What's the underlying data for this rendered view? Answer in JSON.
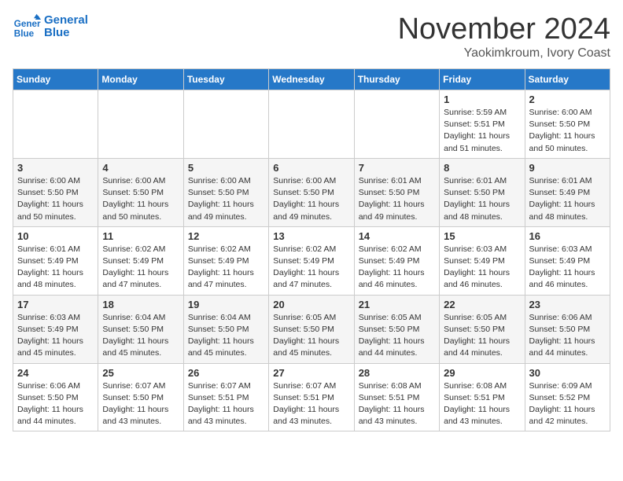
{
  "header": {
    "logo_line1": "General",
    "logo_line2": "Blue",
    "title": "November 2024",
    "subtitle": "Yaokimkroum, Ivory Coast"
  },
  "weekdays": [
    "Sunday",
    "Monday",
    "Tuesday",
    "Wednesday",
    "Thursday",
    "Friday",
    "Saturday"
  ],
  "weeks": [
    [
      {
        "day": "",
        "info": ""
      },
      {
        "day": "",
        "info": ""
      },
      {
        "day": "",
        "info": ""
      },
      {
        "day": "",
        "info": ""
      },
      {
        "day": "",
        "info": ""
      },
      {
        "day": "1",
        "info": "Sunrise: 5:59 AM\nSunset: 5:51 PM\nDaylight: 11 hours\nand 51 minutes."
      },
      {
        "day": "2",
        "info": "Sunrise: 6:00 AM\nSunset: 5:50 PM\nDaylight: 11 hours\nand 50 minutes."
      }
    ],
    [
      {
        "day": "3",
        "info": "Sunrise: 6:00 AM\nSunset: 5:50 PM\nDaylight: 11 hours\nand 50 minutes."
      },
      {
        "day": "4",
        "info": "Sunrise: 6:00 AM\nSunset: 5:50 PM\nDaylight: 11 hours\nand 50 minutes."
      },
      {
        "day": "5",
        "info": "Sunrise: 6:00 AM\nSunset: 5:50 PM\nDaylight: 11 hours\nand 49 minutes."
      },
      {
        "day": "6",
        "info": "Sunrise: 6:00 AM\nSunset: 5:50 PM\nDaylight: 11 hours\nand 49 minutes."
      },
      {
        "day": "7",
        "info": "Sunrise: 6:01 AM\nSunset: 5:50 PM\nDaylight: 11 hours\nand 49 minutes."
      },
      {
        "day": "8",
        "info": "Sunrise: 6:01 AM\nSunset: 5:50 PM\nDaylight: 11 hours\nand 48 minutes."
      },
      {
        "day": "9",
        "info": "Sunrise: 6:01 AM\nSunset: 5:49 PM\nDaylight: 11 hours\nand 48 minutes."
      }
    ],
    [
      {
        "day": "10",
        "info": "Sunrise: 6:01 AM\nSunset: 5:49 PM\nDaylight: 11 hours\nand 48 minutes."
      },
      {
        "day": "11",
        "info": "Sunrise: 6:02 AM\nSunset: 5:49 PM\nDaylight: 11 hours\nand 47 minutes."
      },
      {
        "day": "12",
        "info": "Sunrise: 6:02 AM\nSunset: 5:49 PM\nDaylight: 11 hours\nand 47 minutes."
      },
      {
        "day": "13",
        "info": "Sunrise: 6:02 AM\nSunset: 5:49 PM\nDaylight: 11 hours\nand 47 minutes."
      },
      {
        "day": "14",
        "info": "Sunrise: 6:02 AM\nSunset: 5:49 PM\nDaylight: 11 hours\nand 46 minutes."
      },
      {
        "day": "15",
        "info": "Sunrise: 6:03 AM\nSunset: 5:49 PM\nDaylight: 11 hours\nand 46 minutes."
      },
      {
        "day": "16",
        "info": "Sunrise: 6:03 AM\nSunset: 5:49 PM\nDaylight: 11 hours\nand 46 minutes."
      }
    ],
    [
      {
        "day": "17",
        "info": "Sunrise: 6:03 AM\nSunset: 5:49 PM\nDaylight: 11 hours\nand 45 minutes."
      },
      {
        "day": "18",
        "info": "Sunrise: 6:04 AM\nSunset: 5:50 PM\nDaylight: 11 hours\nand 45 minutes."
      },
      {
        "day": "19",
        "info": "Sunrise: 6:04 AM\nSunset: 5:50 PM\nDaylight: 11 hours\nand 45 minutes."
      },
      {
        "day": "20",
        "info": "Sunrise: 6:05 AM\nSunset: 5:50 PM\nDaylight: 11 hours\nand 45 minutes."
      },
      {
        "day": "21",
        "info": "Sunrise: 6:05 AM\nSunset: 5:50 PM\nDaylight: 11 hours\nand 44 minutes."
      },
      {
        "day": "22",
        "info": "Sunrise: 6:05 AM\nSunset: 5:50 PM\nDaylight: 11 hours\nand 44 minutes."
      },
      {
        "day": "23",
        "info": "Sunrise: 6:06 AM\nSunset: 5:50 PM\nDaylight: 11 hours\nand 44 minutes."
      }
    ],
    [
      {
        "day": "24",
        "info": "Sunrise: 6:06 AM\nSunset: 5:50 PM\nDaylight: 11 hours\nand 44 minutes."
      },
      {
        "day": "25",
        "info": "Sunrise: 6:07 AM\nSunset: 5:50 PM\nDaylight: 11 hours\nand 43 minutes."
      },
      {
        "day": "26",
        "info": "Sunrise: 6:07 AM\nSunset: 5:51 PM\nDaylight: 11 hours\nand 43 minutes."
      },
      {
        "day": "27",
        "info": "Sunrise: 6:07 AM\nSunset: 5:51 PM\nDaylight: 11 hours\nand 43 minutes."
      },
      {
        "day": "28",
        "info": "Sunrise: 6:08 AM\nSunset: 5:51 PM\nDaylight: 11 hours\nand 43 minutes."
      },
      {
        "day": "29",
        "info": "Sunrise: 6:08 AM\nSunset: 5:51 PM\nDaylight: 11 hours\nand 43 minutes."
      },
      {
        "day": "30",
        "info": "Sunrise: 6:09 AM\nSunset: 5:52 PM\nDaylight: 11 hours\nand 42 minutes."
      }
    ]
  ]
}
